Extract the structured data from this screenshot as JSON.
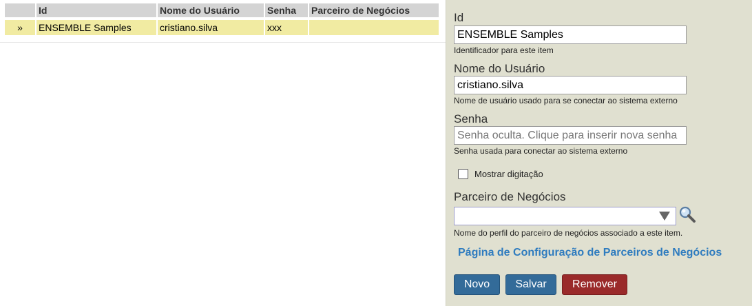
{
  "table": {
    "headers": [
      "",
      "Id",
      "Nome do Usuário",
      "Senha",
      "Parceiro de Negócios"
    ],
    "rows": [
      {
        "selector": "»",
        "id": "ENSEMBLE Samples",
        "username": "cristiano.silva",
        "password": "xxx",
        "partner": ""
      }
    ]
  },
  "form": {
    "id_label": "Id",
    "id_value": "ENSEMBLE Samples",
    "id_hint": "Identificador para este item",
    "user_label": "Nome do Usuário",
    "user_value": "cristiano.silva",
    "user_hint": "Nome de usuário usado para se conectar ao sistema externo",
    "password_label": "Senha",
    "password_placeholder": "Senha oculta. Clique para inserir nova senha",
    "password_hint": "Senha usada para conectar ao sistema externo",
    "show_typing_label": "Mostrar digitação",
    "show_typing_checked": false,
    "partner_label": "Parceiro de Negócios",
    "partner_value": "",
    "partner_hint": "Nome do perfil do parceiro de negócios associado a este item.",
    "config_link": "Página de Configuração de Parceiros de Negócios",
    "buttons": {
      "new": "Novo",
      "save": "Salvar",
      "remove": "Remover"
    }
  },
  "icons": {
    "search": "magnifier-icon",
    "dropdown": "chevron-down-icon"
  },
  "colors": {
    "panel_bg": "#e0e0d0",
    "selected_row": "#f1eba2",
    "link": "#2f7cbf",
    "primary_button": "#336b99",
    "danger_button": "#9a2a2a"
  }
}
